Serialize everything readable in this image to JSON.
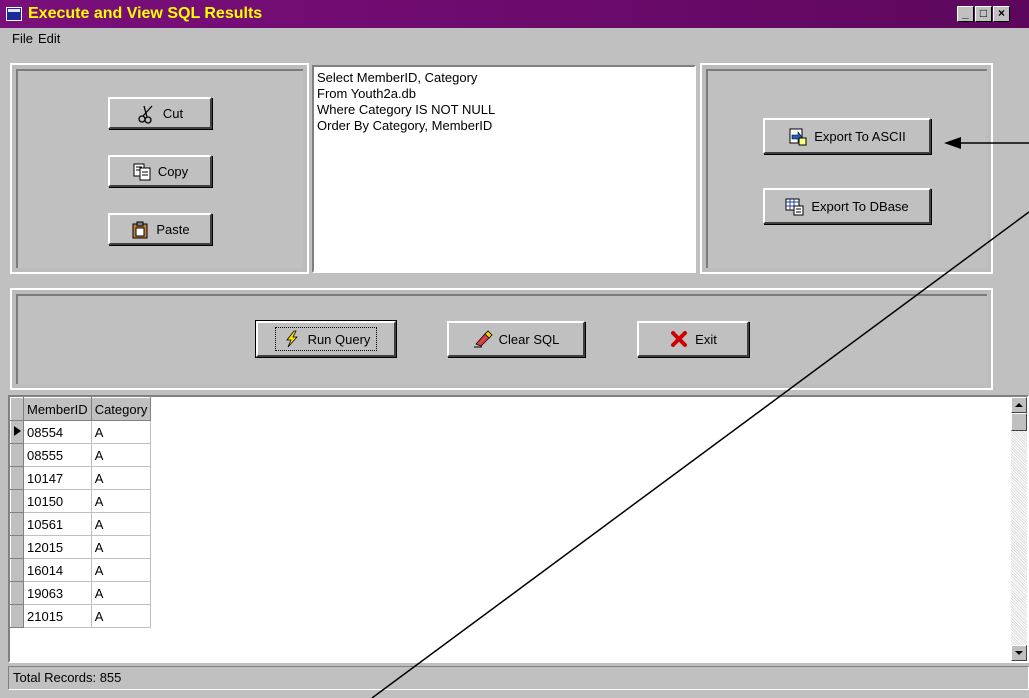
{
  "window": {
    "title": "Execute and View SQL Results"
  },
  "window_buttons": [
    "_",
    "□",
    "×"
  ],
  "menubar": {
    "items": [
      "File",
      "Edit"
    ]
  },
  "edit_panel": {
    "cut_label": "Cut",
    "copy_label": "Copy",
    "paste_label": "Paste"
  },
  "sql": {
    "text": "Select MemberID, Category\nFrom Youth2a.db\nWhere Category IS NOT NULL\nOrder By Category, MemberID"
  },
  "export_panel": {
    "ascii_label": "Export To ASCII",
    "dbase_label": "Export To DBase"
  },
  "actions": {
    "run_label": "Run Query",
    "clear_label": "Clear SQL",
    "exit_label": "Exit"
  },
  "grid": {
    "columns": [
      "MemberID",
      "Category"
    ],
    "rows": [
      [
        "08554",
        "A"
      ],
      [
        "08555",
        "A"
      ],
      [
        "10147",
        "A"
      ],
      [
        "10150",
        "A"
      ],
      [
        "10561",
        "A"
      ],
      [
        "12015",
        "A"
      ],
      [
        "16014",
        "A"
      ],
      [
        "19063",
        "A"
      ],
      [
        "21015",
        "A"
      ]
    ]
  },
  "status": {
    "text": "Total Records: 855"
  },
  "colors": {
    "titlebar": "#7a0f7c",
    "title_text": "#ffff00",
    "face": "#c0c0c0"
  }
}
